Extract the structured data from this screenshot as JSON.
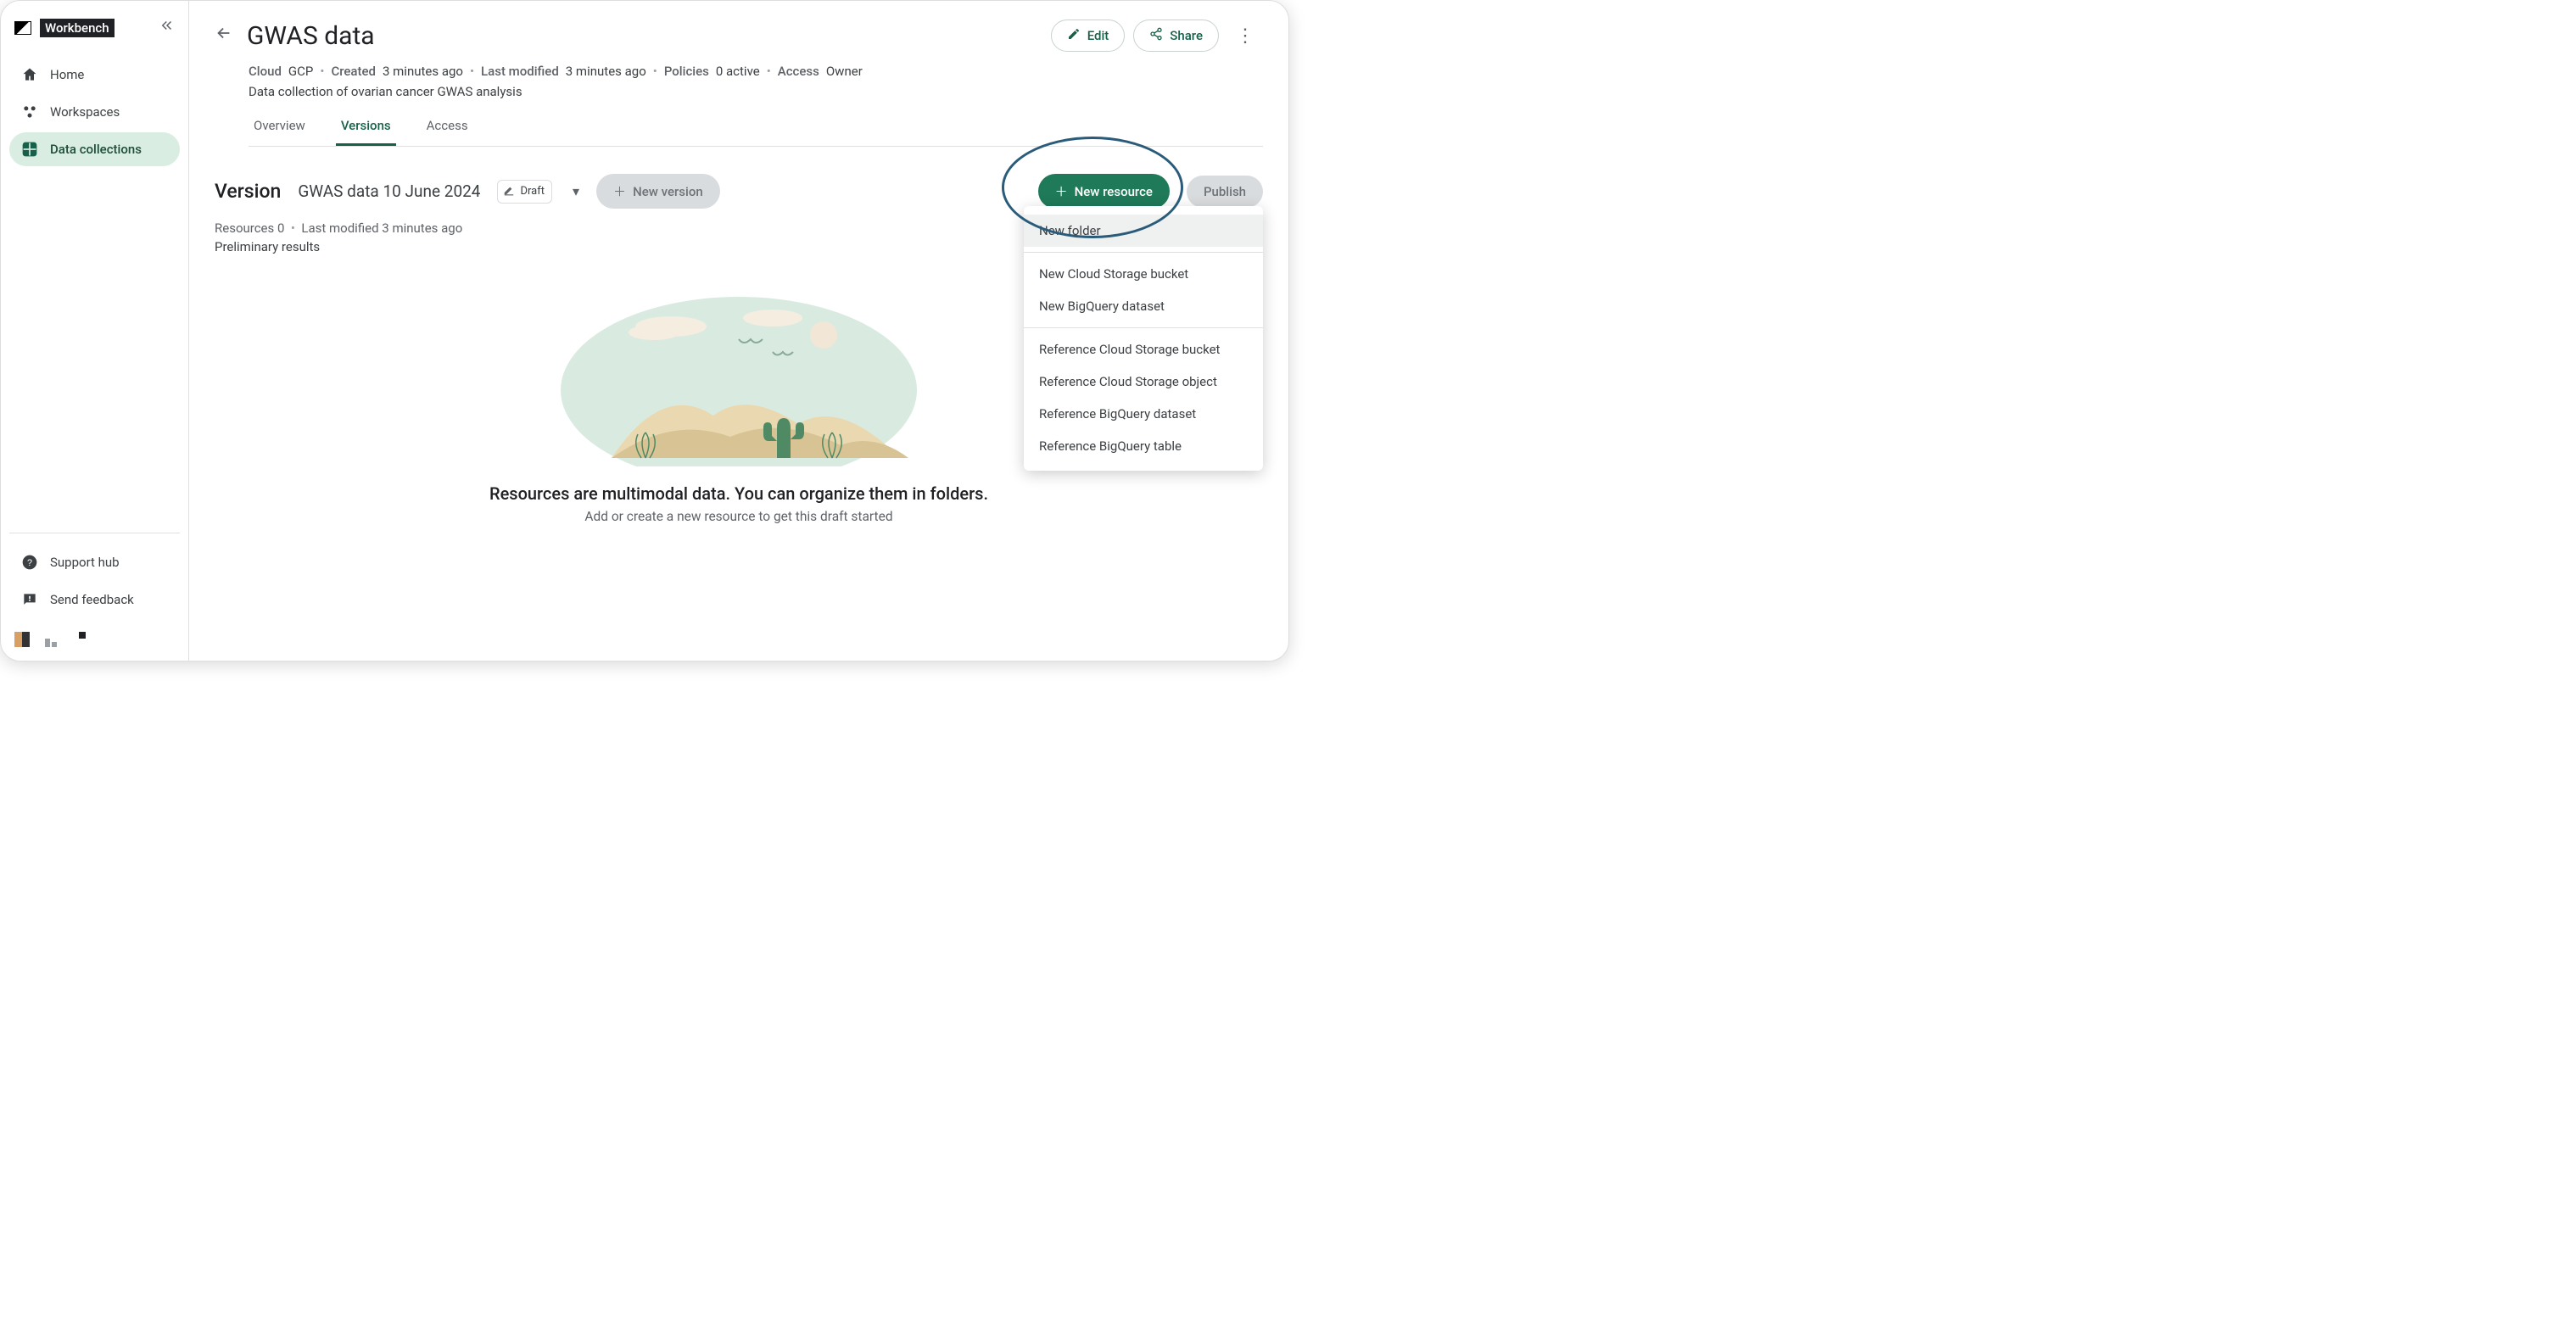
{
  "brand": "Workbench",
  "nav": {
    "home": "Home",
    "workspaces": "Workspaces",
    "dataCollections": "Data collections",
    "supportHub": "Support hub",
    "sendFeedback": "Send feedback"
  },
  "header": {
    "title": "GWAS data",
    "edit": "Edit",
    "share": "Share",
    "meta": {
      "cloudLabel": "Cloud",
      "cloudValue": "GCP",
      "createdLabel": "Created",
      "createdValue": "3 minutes ago",
      "modifiedLabel": "Last modified",
      "modifiedValue": "3 minutes ago",
      "policiesLabel": "Policies",
      "policiesValue": "0 active",
      "accessLabel": "Access",
      "accessValue": "Owner"
    },
    "description": "Data collection of ovarian cancer GWAS analysis"
  },
  "tabs": {
    "overview": "Overview",
    "versions": "Versions",
    "access": "Access"
  },
  "version": {
    "label": "Version",
    "name": "GWAS data 10 June 2024",
    "draft": "Draft",
    "newVersion": "New version",
    "newResource": "New resource",
    "publish": "Publish",
    "resourcesLabel": "Resources",
    "resourcesCount": "0",
    "modifiedLabel": "Last modified",
    "modifiedValue": "3 minutes ago",
    "note": "Preliminary results"
  },
  "empty": {
    "title": "Resources are multimodal data. You can organize them in folders.",
    "subtitle": "Add or create a new resource to get this draft started"
  },
  "menu": {
    "newFolder": "New folder",
    "newBucket": "New Cloud Storage bucket",
    "newBQDataset": "New BigQuery dataset",
    "refBucket": "Reference Cloud Storage bucket",
    "refObject": "Reference Cloud Storage object",
    "refBQDataset": "Reference BigQuery dataset",
    "refBQTable": "Reference BigQuery table"
  }
}
